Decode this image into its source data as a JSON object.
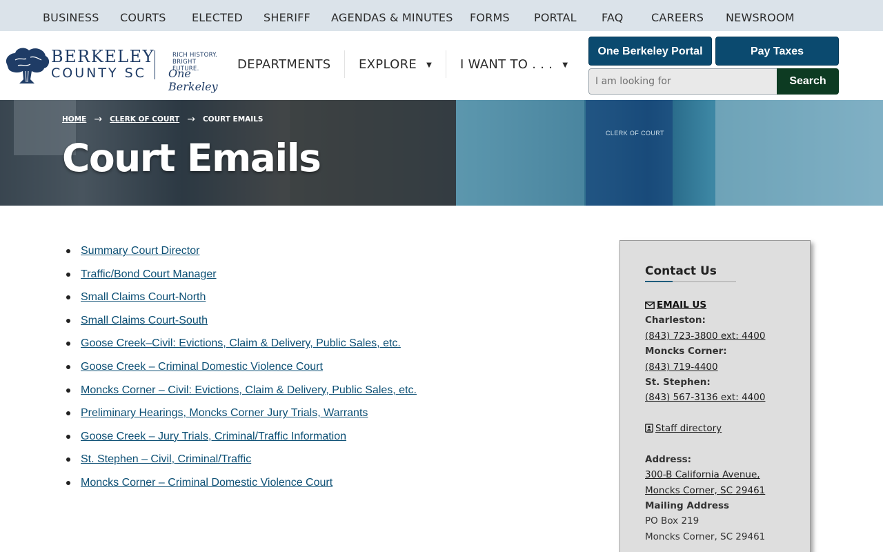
{
  "topnav": {
    "items": [
      "BUSINESS",
      "COURTS",
      "ELECTED",
      "SHERIFF",
      "AGENDAS & MINUTES",
      "FORMS",
      "PORTAL",
      "FAQ",
      "CAREERS",
      "NEWSROOM"
    ]
  },
  "logo": {
    "line1": "BERKELEY",
    "line2": "COUNTY SC",
    "tag1": "RICH HISTORY.",
    "tag2": "BRIGHT FUTURE.",
    "script": "One Berkeley"
  },
  "mainnav": {
    "departments": "DEPARTMENTS",
    "explore": "EXPLORE",
    "iwant": "I WANT TO . . ."
  },
  "header_buttons": {
    "portal": "One Berkeley Portal",
    "taxes": "Pay Taxes"
  },
  "search": {
    "placeholder": "I am looking for",
    "button": "Search"
  },
  "banner": {
    "cup_text": "CLERK OF COURT"
  },
  "breadcrumb": {
    "home": "HOME",
    "clerk": "CLERK OF COURT",
    "current": "COURT EMAILS"
  },
  "page": {
    "title": "Court Emails"
  },
  "emails": [
    "Summary Court Director",
    "Traffic/Bond Court Manager",
    "Small Claims Court-North",
    "Small Claims Court-South",
    "Goose Creek–Civil: Evictions, Claim & Delivery, Public Sales, etc.",
    "Goose Creek – Criminal Domestic Violence Court",
    "Moncks Corner – Civil: Evictions, Claim & Delivery, Public Sales, etc.",
    "Preliminary Hearings, Moncks Corner Jury Trials, Warrants",
    "Goose Creek – Jury Trials, Criminal/Traffic Information",
    "St. Stephen – Civil, Criminal/Traffic",
    "Moncks Corner – Criminal Domestic Violence Court"
  ],
  "contact": {
    "title": "Contact Us",
    "email_label": "EMAIL US",
    "charleston_label": "Charleston:",
    "charleston_phone": "(843) 723-3800 ext: 4400",
    "moncks_label": "Moncks Corner:",
    "moncks_phone": "(843) 719-4400",
    "stephen_label": "St. Stephen:",
    "stephen_phone": "(843) 567-3136 ext: 4400",
    "staff_directory": "Staff directory",
    "address_label": "Address:",
    "address_line1": "300-B California Avenue,",
    "address_line2": "Moncks Corner, SC 29461",
    "mailing_label": "Mailing Address",
    "mailing_line1": "PO Box 219",
    "mailing_line2": "Moncks Corner, SC 29461"
  },
  "colors": {
    "topbar_bg": "#dbe3ea",
    "primary_button": "#0b4a6f",
    "search_button": "#0d3b22",
    "link": "#0d5075",
    "panel_bg": "#dedede"
  }
}
